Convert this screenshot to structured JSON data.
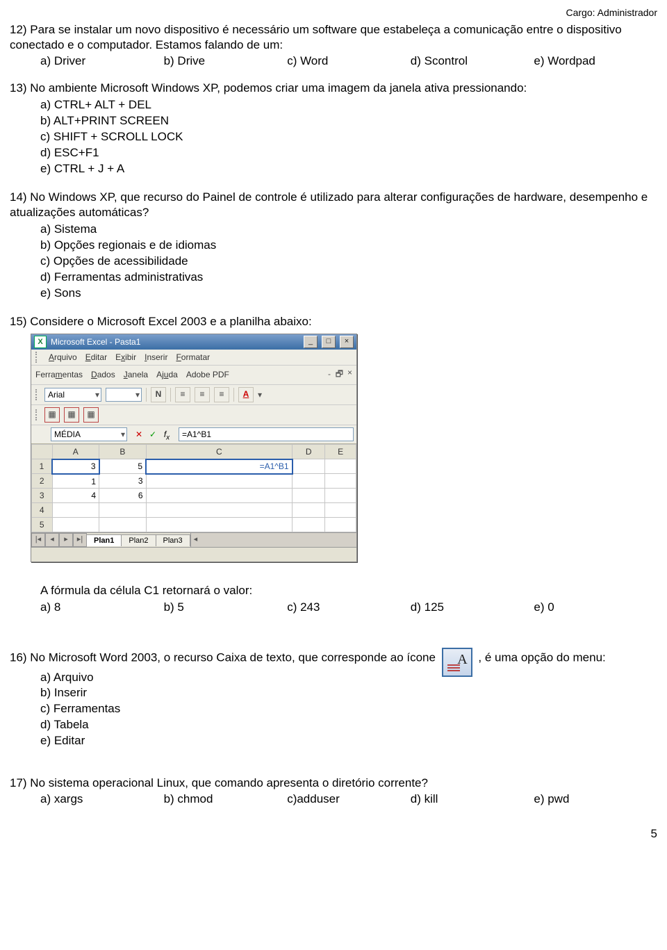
{
  "header": {
    "cargo": "Cargo: Administrador"
  },
  "q12": {
    "text": "12) Para se instalar um novo dispositivo é necessário um software que estabeleça a comunicação entre o dispositivo conectado e o computador. Estamos falando de um:",
    "a": "a) Driver",
    "b": "b) Drive",
    "c": "c) Word",
    "d": "d) Scontrol",
    "e": "e) Wordpad"
  },
  "q13": {
    "text": "13) No ambiente Microsoft Windows XP, podemos criar uma imagem da janela ativa pressionando:",
    "a": "a) CTRL+ ALT + DEL",
    "b": "b) ALT+PRINT SCREEN",
    "c": "c) SHIFT + SCROLL LOCK",
    "d": "d) ESC+F1",
    "e": "e) CTRL + J + A"
  },
  "q14": {
    "text": "14) No Windows XP, que recurso do Painel de controle é utilizado para alterar configurações de hardware, desempenho e atualizações automáticas?",
    "a": "a) Sistema",
    "b": "b) Opções regionais e de idiomas",
    "c": "c) Opções de acessibilidade",
    "d": "d) Ferramentas administrativas",
    "e": "e) Sons"
  },
  "q15": {
    "text": "15) Considere o Microsoft Excel 2003 e a planilha abaixo:",
    "follow": "A fórmula da célula C1 retornará o valor:",
    "a": "a) 8",
    "b": "b) 5",
    "c": "c) 243",
    "d": "d) 125",
    "e": "e) 0"
  },
  "q16": {
    "pre": "16) No Microsoft Word 2003, o recurso Caixa de texto, que corresponde ao ícone ",
    "post": ", é uma opção do menu:",
    "a": "a) Arquivo",
    "b": "b) Inserir",
    "c": "c) Ferramentas",
    "d": "d) Tabela",
    "e": "e) Editar"
  },
  "q17": {
    "text": "17) No sistema operacional Linux, que comando apresenta o diretório corrente?",
    "a": "a) xargs",
    "b": "b) chmod",
    "c": "c)adduser",
    "d": "d) kill",
    "e": "e) pwd"
  },
  "excel": {
    "title": "Microsoft Excel - Pasta1",
    "menus": {
      "arquivo": "Arquivo",
      "editar": "Editar",
      "exibir": "Exibir",
      "inserir": "Inserir",
      "formatar": "Formatar",
      "ferramentas": "Ferramentas",
      "dados": "Dados",
      "janela": "Janela",
      "ajuda": "Ajuda",
      "adobe": "Adobe PDF"
    },
    "font": "Arial",
    "name_box": "MÉDIA",
    "formula": "=A1^B1",
    "headers": [
      "A",
      "B",
      "C",
      "D",
      "E"
    ],
    "rows": [
      {
        "n": "1",
        "A": "3",
        "B": "5",
        "C": "=A1^B1",
        "D": "",
        "E": ""
      },
      {
        "n": "2",
        "A": "1",
        "B": "3",
        "C": "",
        "D": "",
        "E": ""
      },
      {
        "n": "3",
        "A": "4",
        "B": "6",
        "C": "",
        "D": "",
        "E": ""
      },
      {
        "n": "4",
        "A": "",
        "B": "",
        "C": "",
        "D": "",
        "E": ""
      },
      {
        "n": "5",
        "A": "",
        "B": "",
        "C": "",
        "D": "",
        "E": ""
      }
    ],
    "tabs": {
      "t1": "Plan1",
      "t2": "Plan2",
      "t3": "Plan3"
    }
  },
  "page_number": "5"
}
